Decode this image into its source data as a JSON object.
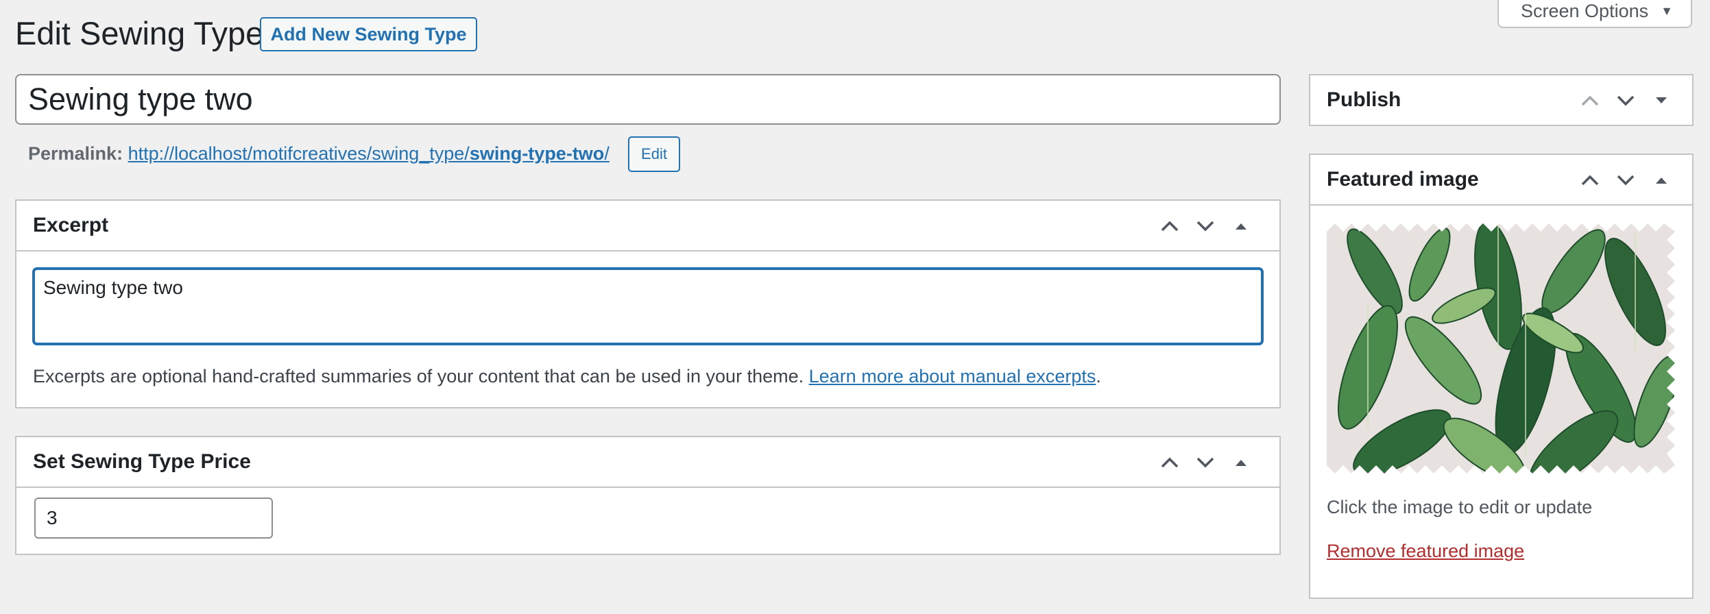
{
  "header": {
    "title": "Edit Sewing Type",
    "add_new_label": "Add New Sewing Type",
    "screen_options_label": "Screen Options"
  },
  "post": {
    "title_value": "Sewing type two",
    "permalink_label": "Permalink:",
    "permalink_base": "http://localhost/motifcreatives/swing_type/",
    "permalink_slug": "swing-type-two",
    "permalink_trailing": "/",
    "permalink_edit_label": "Edit"
  },
  "excerpt": {
    "heading": "Excerpt",
    "value": "Sewing type two",
    "help_text": "Excerpts are optional hand-crafted summaries of your content that can be used in your theme.",
    "help_link": "Learn more about manual excerpts",
    "help_end": "."
  },
  "price": {
    "heading": "Set Sewing Type Price",
    "value": "3"
  },
  "sidebar": {
    "publish_heading": "Publish",
    "featured_heading": "Featured image",
    "featured_note": "Click the image to edit or update",
    "remove_label": "Remove featured image"
  },
  "colors": {
    "accent": "#2271b1",
    "danger": "#b32d2e",
    "background": "#f0f0f1"
  },
  "icons": {
    "move_up": "chevron-up-icon",
    "move_down": "chevron-down-icon",
    "toggle": "triangle-toggle-icon",
    "screen_options": "triangle-down-icon"
  }
}
